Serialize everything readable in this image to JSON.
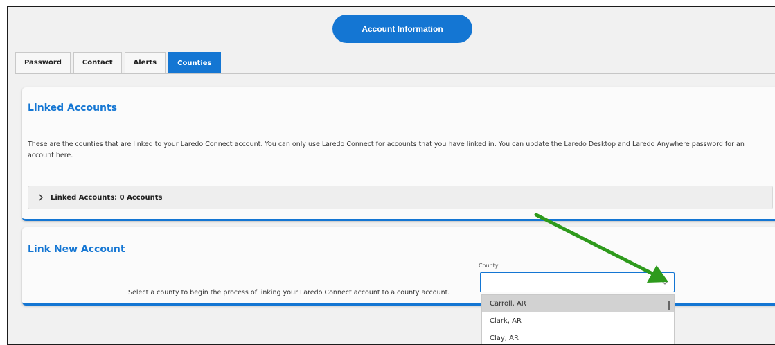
{
  "header": {
    "title": "Account Information"
  },
  "tabs": [
    {
      "label": "Password",
      "active": false
    },
    {
      "label": "Contact",
      "active": false
    },
    {
      "label": "Alerts",
      "active": false
    },
    {
      "label": "Counties",
      "active": true
    }
  ],
  "linked_accounts": {
    "title": "Linked Accounts",
    "description": "These are the counties that are linked to your Laredo Connect account. You can only use Laredo Connect for accounts that you have linked in. You can update the Laredo Desktop and Laredo Anywhere password for an account here.",
    "accordion_label": "Linked Accounts: 0 Accounts"
  },
  "link_new_account": {
    "title": "Link New Account",
    "instruction": "Select a county to begin the process of linking your Laredo Connect account to a county account.",
    "county_label": "County",
    "county_value": "",
    "options": [
      "Carroll, AR",
      "Clark, AR",
      "Clay, AR"
    ],
    "highlighted_index": 0
  },
  "colors": {
    "accent": "#1476d3",
    "annotation_arrow": "#2e9a1c"
  },
  "icons": {
    "accordion": "chevron-right-icon",
    "select": "chevron-down-icon",
    "annotation": "green-arrow-icon"
  }
}
